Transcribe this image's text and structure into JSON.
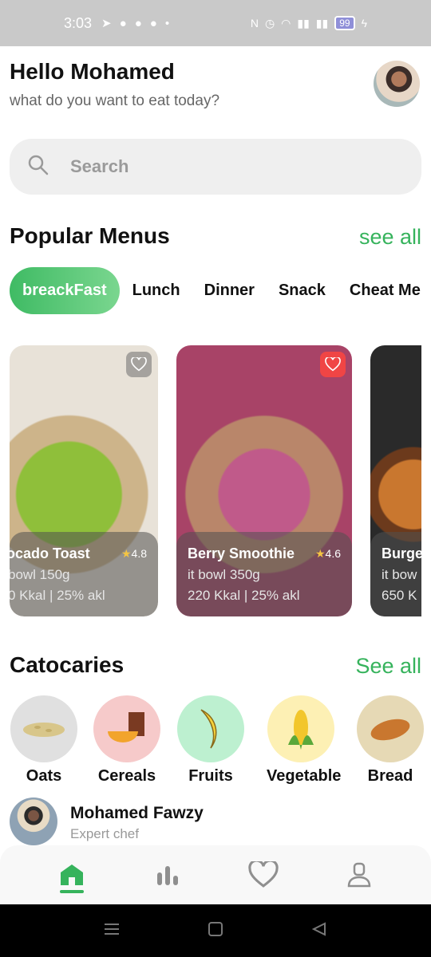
{
  "status_bar": {
    "time": "3:03",
    "battery": "99"
  },
  "header": {
    "greeting": "Hello Mohamed",
    "subtitle": "what do you want to eat today?"
  },
  "search": {
    "placeholder": "Search"
  },
  "popular": {
    "title": "Popular Menus",
    "see_all": "see all"
  },
  "tabs": [
    "breackFast",
    "Lunch",
    "Dinner",
    "Snack",
    "Cheat Me"
  ],
  "menus": [
    {
      "name": "ocado Toast",
      "rating": "4.8",
      "weight": "bowl 150g",
      "kcal": "0 Kkal | 25% akl",
      "favorite": false
    },
    {
      "name": "Berry Smoothie",
      "rating": "4.6",
      "weight": "it bowl 350g",
      "kcal": "220 Kkal | 25% akl",
      "favorite": true
    },
    {
      "name": "Burge",
      "rating": "",
      "weight": "it bow",
      "kcal": "650 K",
      "favorite": false
    }
  ],
  "categories_section": {
    "title": "Catocaries",
    "see_all": "See all"
  },
  "categories": [
    {
      "label": "Oats",
      "bg": "#e0e0e0",
      "icon": "oats-icon"
    },
    {
      "label": "Cereals",
      "bg": "#f6caca",
      "icon": "cereal-icon"
    },
    {
      "label": "Fruits",
      "bg": "#bdf0d0",
      "icon": "banana-icon"
    },
    {
      "label": "Vegetable",
      "bg": "#fdf0b4",
      "icon": "corn-icon"
    },
    {
      "label": "Bread",
      "bg": "#e6d9b5",
      "icon": "bread-icon"
    }
  ],
  "chef": {
    "name": "Mohamed Fawzy",
    "role": "Expert chef"
  },
  "colors": {
    "accent": "#36b35c",
    "tab_active_start": "#3fbb64",
    "tab_active_end": "#7ad68f",
    "heart_active": "#f04545"
  }
}
